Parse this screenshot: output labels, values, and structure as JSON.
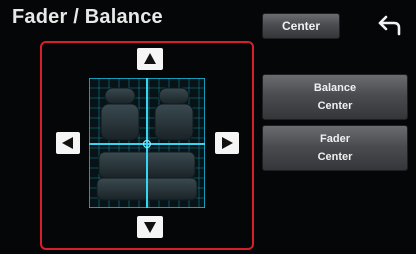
{
  "header": {
    "title": "Fader / Balance",
    "center_label": "Center"
  },
  "controls": {
    "up": "up-arrow",
    "down": "down-arrow",
    "left": "left-arrow",
    "right": "right-arrow"
  },
  "balance": {
    "label": "Balance",
    "value": "Center"
  },
  "fader": {
    "label": "Fader",
    "value": "Center"
  },
  "colors": {
    "accent": "#d81e2a",
    "grid": "#1cc6e8"
  }
}
